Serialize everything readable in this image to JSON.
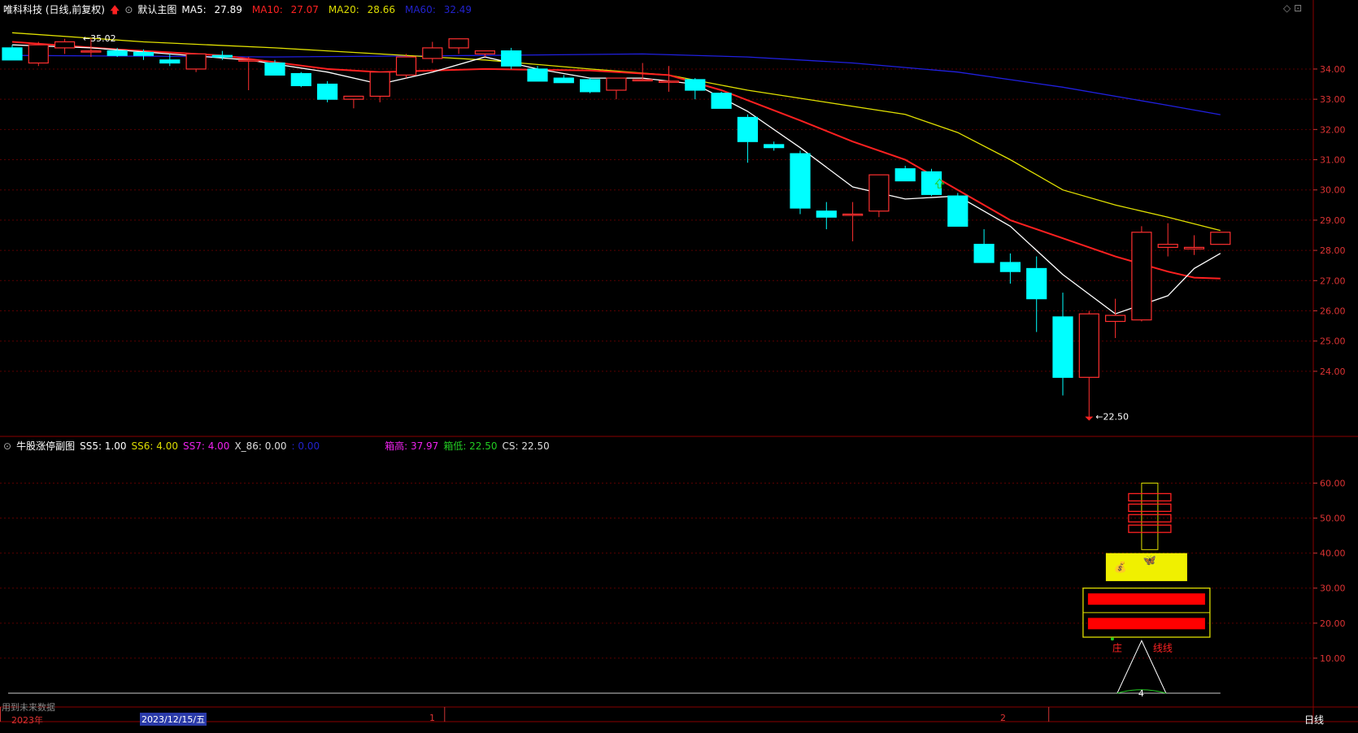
{
  "header": {
    "stock": "唯科科技 (日线,前复权)",
    "main_name": "默认主图",
    "ma5_label": "MA5:",
    "ma5_val": "27.89",
    "ma10_label": "MA10:",
    "ma10_val": "27.07",
    "ma20_label": "MA20:",
    "ma20_val": "28.66",
    "ma60_label": "MA60:",
    "ma60_val": "32.49"
  },
  "sub_header": {
    "name": "牛股涨停副图",
    "ss5": "SS5: 1.00",
    "ss6": "SS6: 4.00",
    "ss7": "SS7: 4.00",
    "x86": "X_86: 0.00",
    "dot": ": 0.00",
    "box_high": "箱高: 37.97",
    "box_low": "箱低: 22.50",
    "cs": "CS: 22.50"
  },
  "annotations": {
    "high_label": "35.02",
    "low_label": "22.50",
    "zhuang": "庄",
    "line_label": "线线",
    "count": "4"
  },
  "footer": {
    "future_data": "用到未来数据",
    "year": "2023年",
    "date": "2023/12/15/五",
    "month1": "1",
    "month2": "2",
    "period": "日线"
  },
  "colors": {
    "up": "#ff3030",
    "down": "#00ffff",
    "ma5": "#ffffff",
    "ma10": "#ff2020",
    "ma20": "#e0e000",
    "ma60": "#2020e0",
    "grid": "#5a0000"
  },
  "chart_data": [
    {
      "type": "candlestick",
      "title": "唯科科技 (日线,前复权)",
      "y_ticks": [
        34,
        33,
        32,
        31,
        30,
        29,
        28,
        27,
        26,
        25,
        24
      ],
      "ylim": [
        21.9,
        35.8
      ],
      "candles": [
        {
          "o": 34.7,
          "h": 34.8,
          "l": 34.3,
          "c": 34.3
        },
        {
          "o": 34.2,
          "h": 34.9,
          "l": 34.1,
          "c": 34.8
        },
        {
          "o": 34.7,
          "h": 35.0,
          "l": 34.5,
          "c": 34.9
        },
        {
          "o": 34.6,
          "h": 35.02,
          "l": 34.4,
          "c": 34.6
        },
        {
          "o": 34.6,
          "h": 34.7,
          "l": 34.4,
          "c": 34.45
        },
        {
          "o": 34.55,
          "h": 34.65,
          "l": 34.3,
          "c": 34.45
        },
        {
          "o": 34.3,
          "h": 34.5,
          "l": 34.1,
          "c": 34.2
        },
        {
          "o": 34.0,
          "h": 34.5,
          "l": 33.9,
          "c": 34.5
        },
        {
          "o": 34.45,
          "h": 34.6,
          "l": 34.3,
          "c": 34.4
        },
        {
          "o": 34.3,
          "h": 34.4,
          "l": 33.3,
          "c": 34.3
        },
        {
          "o": 34.2,
          "h": 34.3,
          "l": 33.8,
          "c": 33.8
        },
        {
          "o": 33.85,
          "h": 33.9,
          "l": 33.4,
          "c": 33.45
        },
        {
          "o": 33.5,
          "h": 33.6,
          "l": 32.9,
          "c": 33.0
        },
        {
          "o": 33.0,
          "h": 33.1,
          "l": 32.7,
          "c": 33.1
        },
        {
          "o": 33.1,
          "h": 33.9,
          "l": 32.9,
          "c": 33.9
        },
        {
          "o": 33.8,
          "h": 34.5,
          "l": 33.7,
          "c": 34.4
        },
        {
          "o": 34.35,
          "h": 34.9,
          "l": 34.2,
          "c": 34.7
        },
        {
          "o": 34.7,
          "h": 35.0,
          "l": 34.5,
          "c": 35.0
        },
        {
          "o": 34.5,
          "h": 34.6,
          "l": 34.4,
          "c": 34.6
        },
        {
          "o": 34.6,
          "h": 34.7,
          "l": 34.0,
          "c": 34.1
        },
        {
          "o": 34.0,
          "h": 34.1,
          "l": 33.6,
          "c": 33.6
        },
        {
          "o": 33.7,
          "h": 33.8,
          "l": 33.55,
          "c": 33.55
        },
        {
          "o": 33.65,
          "h": 33.7,
          "l": 33.2,
          "c": 33.25
        },
        {
          "o": 33.3,
          "h": 33.7,
          "l": 33.0,
          "c": 33.7
        },
        {
          "o": 33.65,
          "h": 34.2,
          "l": 33.6,
          "c": 33.65
        },
        {
          "o": 33.6,
          "h": 34.1,
          "l": 33.25,
          "c": 33.6
        },
        {
          "o": 33.65,
          "h": 33.7,
          "l": 33.0,
          "c": 33.3
        },
        {
          "o": 33.2,
          "h": 33.25,
          "l": 32.7,
          "c": 32.7
        },
        {
          "o": 32.4,
          "h": 32.5,
          "l": 30.9,
          "c": 31.6
        },
        {
          "o": 31.5,
          "h": 31.6,
          "l": 31.3,
          "c": 31.4
        },
        {
          "o": 31.2,
          "h": 31.3,
          "l": 29.2,
          "c": 29.4
        },
        {
          "o": 29.3,
          "h": 29.6,
          "l": 28.7,
          "c": 29.1
        },
        {
          "o": 29.2,
          "h": 29.6,
          "l": 28.3,
          "c": 29.2
        },
        {
          "o": 29.3,
          "h": 30.5,
          "l": 29.1,
          "c": 30.5
        },
        {
          "o": 30.7,
          "h": 30.8,
          "l": 30.3,
          "c": 30.3
        },
        {
          "o": 30.6,
          "h": 30.7,
          "l": 29.8,
          "c": 29.85
        },
        {
          "o": 29.8,
          "h": 29.9,
          "l": 28.8,
          "c": 28.8
        },
        {
          "o": 28.2,
          "h": 28.7,
          "l": 27.7,
          "c": 27.6
        },
        {
          "o": 27.6,
          "h": 27.9,
          "l": 26.9,
          "c": 27.3
        },
        {
          "o": 27.4,
          "h": 27.8,
          "l": 25.3,
          "c": 26.4
        },
        {
          "o": 25.8,
          "h": 26.6,
          "l": 23.2,
          "c": 23.8
        },
        {
          "o": 23.8,
          "h": 26.0,
          "l": 22.5,
          "c": 25.9
        },
        {
          "o": 25.65,
          "h": 26.4,
          "l": 25.1,
          "c": 25.85
        },
        {
          "o": 25.7,
          "h": 28.8,
          "l": 25.65,
          "c": 28.6
        },
        {
          "o": 28.1,
          "h": 28.9,
          "l": 27.8,
          "c": 28.2
        },
        {
          "o": 28.05,
          "h": 28.5,
          "l": 27.85,
          "c": 28.1
        },
        {
          "o": 28.2,
          "h": 28.6,
          "l": 28.2,
          "c": 28.6
        }
      ],
      "ma5": [
        [
          0,
          34.8
        ],
        [
          3,
          34.7
        ],
        [
          6,
          34.5
        ],
        [
          9,
          34.3
        ],
        [
          12,
          33.9
        ],
        [
          14,
          33.5
        ],
        [
          16,
          33.9
        ],
        [
          18,
          34.4
        ],
        [
          20,
          34.0
        ],
        [
          22,
          33.7
        ],
        [
          24,
          33.7
        ],
        [
          26,
          33.5
        ],
        [
          28,
          32.6
        ],
        [
          30,
          31.4
        ],
        [
          32,
          30.1
        ],
        [
          34,
          29.7
        ],
        [
          36,
          29.8
        ],
        [
          38,
          28.8
        ],
        [
          40,
          27.2
        ],
        [
          42,
          25.9
        ],
        [
          44,
          26.5
        ],
        [
          45,
          27.4
        ],
        [
          46,
          27.9
        ]
      ],
      "ma10": [
        [
          0,
          34.9
        ],
        [
          4,
          34.65
        ],
        [
          8,
          34.45
        ],
        [
          12,
          34.0
        ],
        [
          14,
          33.9
        ],
        [
          18,
          34.0
        ],
        [
          22,
          33.95
        ],
        [
          25,
          33.8
        ],
        [
          27,
          33.3
        ],
        [
          30,
          32.3
        ],
        [
          32,
          31.6
        ],
        [
          34,
          31.0
        ],
        [
          36,
          30.0
        ],
        [
          38,
          29.0
        ],
        [
          40,
          28.4
        ],
        [
          42,
          27.8
        ],
        [
          44,
          27.3
        ],
        [
          45,
          27.1
        ],
        [
          46,
          27.07
        ]
      ],
      "ma20": [
        [
          0,
          35.2
        ],
        [
          5,
          34.9
        ],
        [
          10,
          34.7
        ],
        [
          14,
          34.5
        ],
        [
          18,
          34.3
        ],
        [
          22,
          34.0
        ],
        [
          25,
          33.8
        ],
        [
          28,
          33.3
        ],
        [
          31,
          32.9
        ],
        [
          34,
          32.5
        ],
        [
          36,
          31.9
        ],
        [
          38,
          31.0
        ],
        [
          40,
          30.0
        ],
        [
          42,
          29.5
        ],
        [
          44,
          29.1
        ],
        [
          46,
          28.66
        ]
      ],
      "ma60": [
        [
          0,
          34.45
        ],
        [
          10,
          34.4
        ],
        [
          18,
          34.45
        ],
        [
          24,
          34.5
        ],
        [
          28,
          34.4
        ],
        [
          32,
          34.2
        ],
        [
          36,
          33.9
        ],
        [
          40,
          33.4
        ],
        [
          44,
          32.8
        ],
        [
          46,
          32.49
        ]
      ]
    },
    {
      "type": "indicator",
      "title": "牛股涨停副图",
      "y_ticks": [
        60,
        50,
        40,
        30,
        20,
        10
      ],
      "ylim": [
        0,
        68
      ]
    }
  ]
}
